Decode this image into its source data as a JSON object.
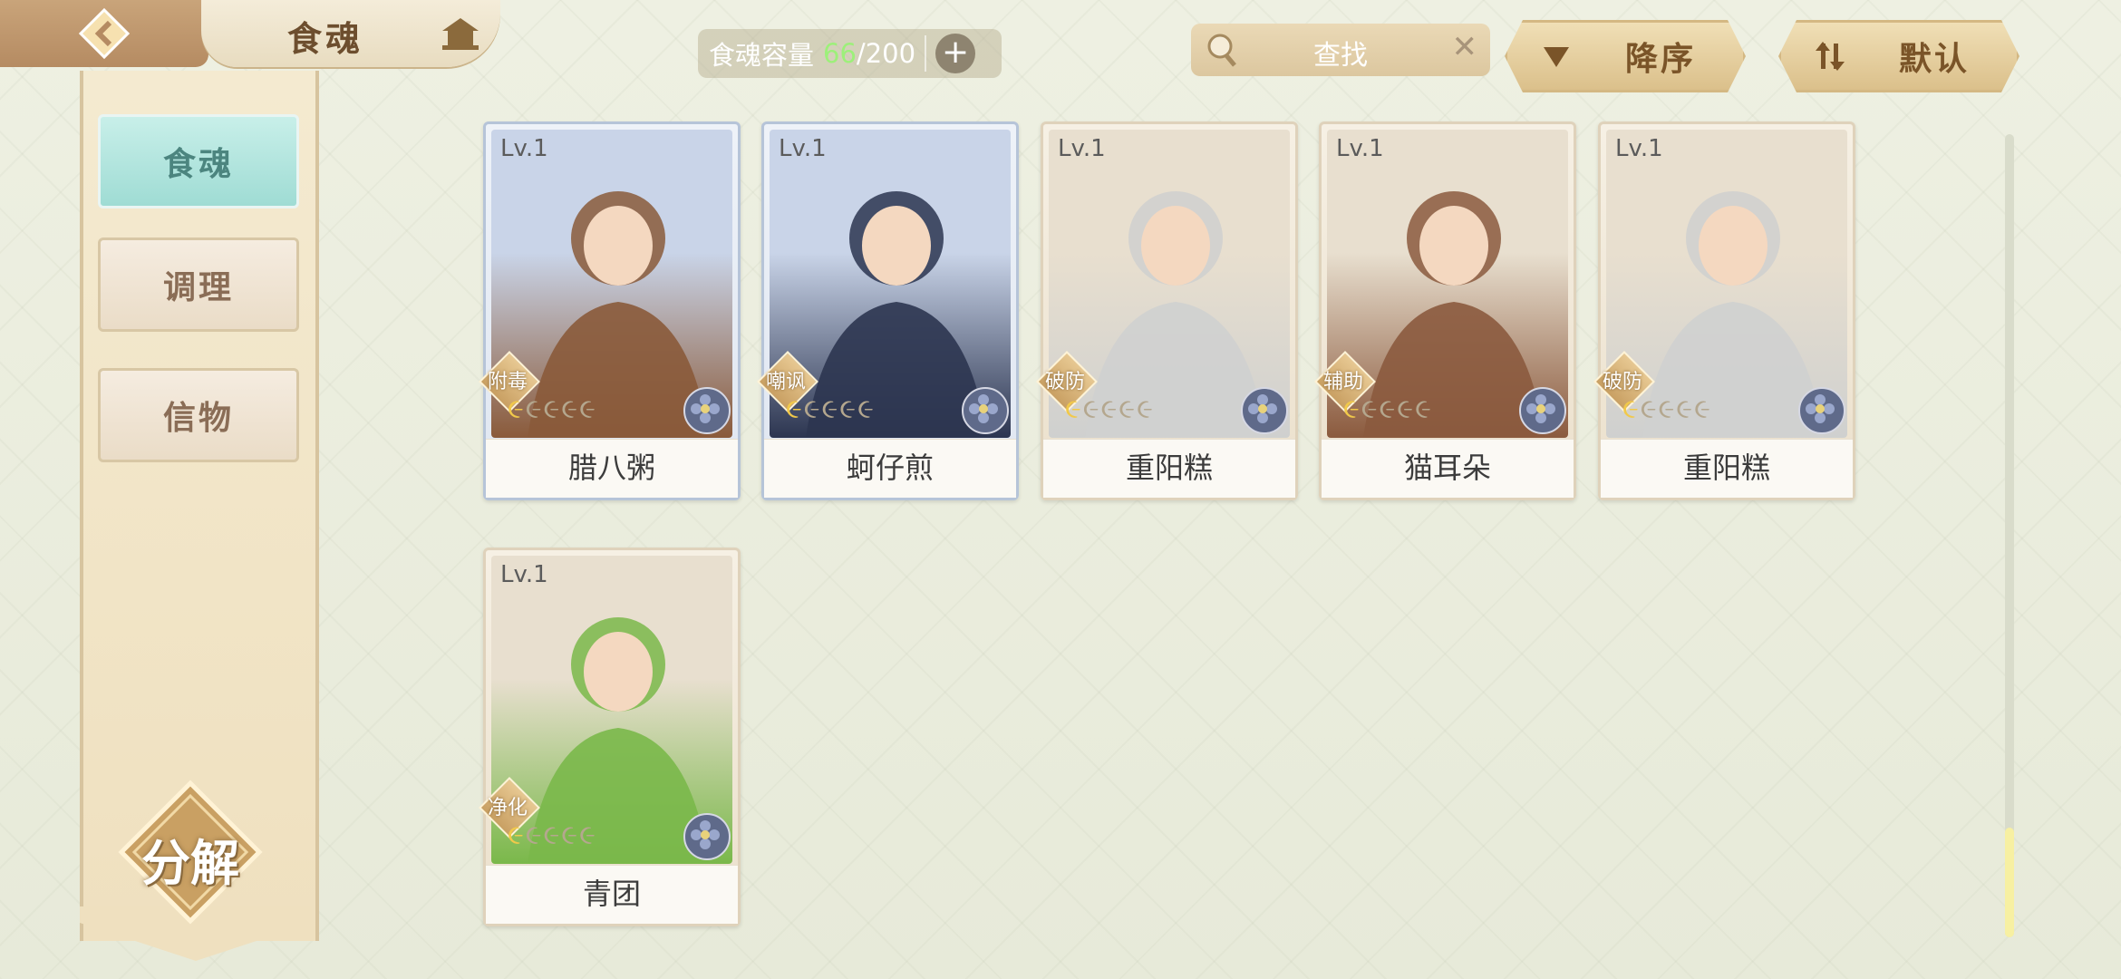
{
  "header": {
    "title": "食魂",
    "capacity": {
      "label": "食魂容量",
      "current": "66",
      "separator": "/",
      "max": "200"
    },
    "search": {
      "label": "查找"
    },
    "sort_desc_label": "降序",
    "sort_default_label": "默认"
  },
  "sidebar": {
    "tabs": [
      {
        "label": "食魂",
        "active": true
      },
      {
        "label": "调理",
        "active": false
      },
      {
        "label": "信物",
        "active": false
      }
    ],
    "decompose_label": "分解"
  },
  "cards": [
    {
      "level": "Lv.1",
      "role": "附毒",
      "name": "腊八粥",
      "stars_lit": 1,
      "stars_total": 5,
      "frame": "blue",
      "portrait_colors": [
        "#c9d4e8",
        "#8a5a3a"
      ]
    },
    {
      "level": "Lv.1",
      "role": "嘲讽",
      "name": "蚵仔煎",
      "stars_lit": 1,
      "stars_total": 5,
      "frame": "blue",
      "portrait_colors": [
        "#c9d4e8",
        "#2c3550"
      ]
    },
    {
      "level": "Lv.1",
      "role": "破防",
      "name": "重阳糕",
      "stars_lit": 1,
      "stars_total": 5,
      "frame": "beige",
      "portrait_colors": [
        "#e8dfcf",
        "#cfd0cf"
      ]
    },
    {
      "level": "Lv.1",
      "role": "辅助",
      "name": "猫耳朵",
      "stars_lit": 1,
      "stars_total": 5,
      "frame": "beige",
      "portrait_colors": [
        "#e8dfcf",
        "#8b5a3e"
      ]
    },
    {
      "level": "Lv.1",
      "role": "破防",
      "name": "重阳糕",
      "stars_lit": 1,
      "stars_total": 5,
      "frame": "beige",
      "portrait_colors": [
        "#e8dfcf",
        "#cfd0cf"
      ]
    },
    {
      "level": "Lv.1",
      "role": "净化",
      "name": "青团",
      "stars_lit": 1,
      "stars_total": 5,
      "frame": "beige",
      "portrait_colors": [
        "#e8dfcf",
        "#7ab84a"
      ]
    }
  ],
  "scroll": {
    "position_fraction": 0.86
  },
  "colors": {
    "accent_teal": "#9fdcd4",
    "gold": "#dbc08b",
    "capacity_current": "#9df07a"
  }
}
